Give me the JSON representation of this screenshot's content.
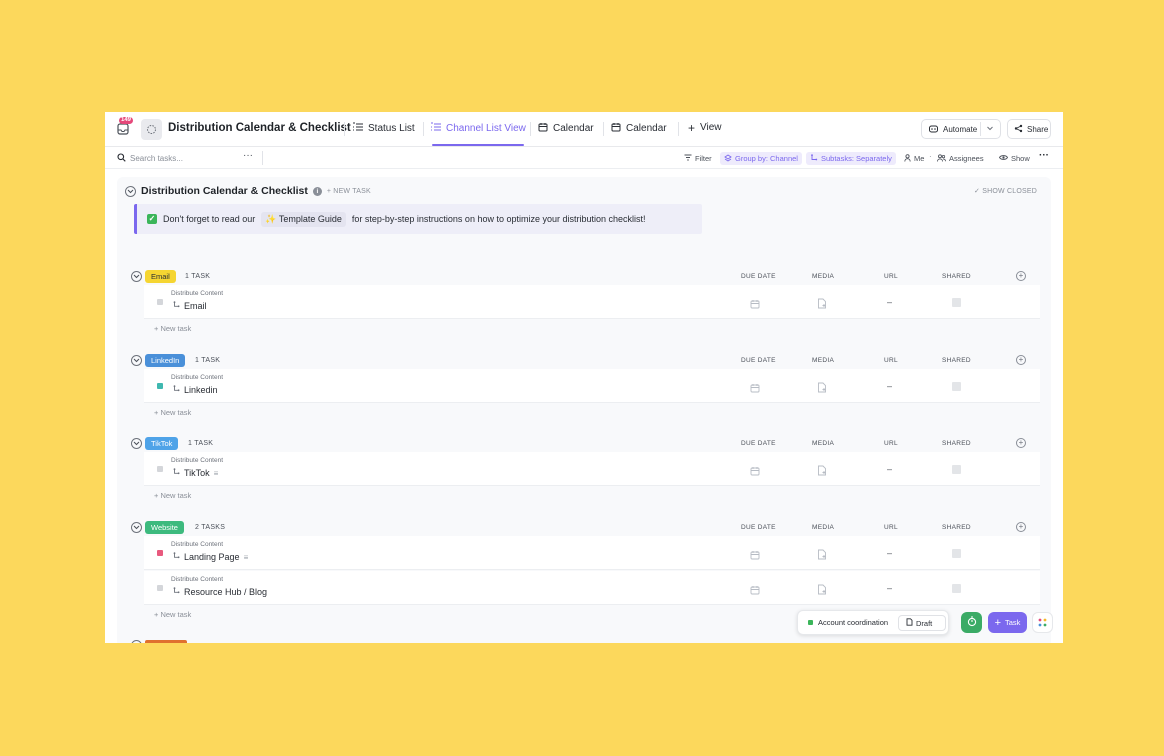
{
  "header": {
    "notification_count": "149",
    "title": "Distribution Calendar & Checklist",
    "tabs": [
      {
        "label": "Status List"
      },
      {
        "label": "Channel List View"
      },
      {
        "label": "Calendar"
      },
      {
        "label": "Calendar"
      }
    ],
    "add_view": "View",
    "automate": "Automate",
    "share": "Share"
  },
  "toolbar": {
    "search_placeholder": "Search tasks...",
    "filter": "Filter",
    "group_by": "Group by: Channel",
    "subtasks": "Subtasks: Separately",
    "me": "Me",
    "assignees": "Assignees",
    "show": "Show"
  },
  "list": {
    "title": "Distribution Calendar & Checklist",
    "new_task": "+ NEW TASK",
    "show_closed": "SHOW CLOSED",
    "callout_before": "Don't forget to read our",
    "callout_guide": "Template Guide",
    "callout_after": "for step-by-step instructions on how to optimize your distribution checklist!"
  },
  "columns": {
    "due_date": "DUE DATE",
    "media": "MEDIA",
    "url": "URL",
    "shared": "SHARED"
  },
  "groups": [
    {
      "name": "Email",
      "color": "#f5d532",
      "text_color": "#292d34",
      "count": "1 TASK",
      "tasks": [
        {
          "parent": "Distribute Content",
          "name": "Email",
          "status_color": "#d4d6da",
          "url": "–"
        }
      ]
    },
    {
      "name": "LinkedIn",
      "color": "#4a90d9",
      "text_color": "#ffffff",
      "count": "1 TASK",
      "tasks": [
        {
          "parent": "Distribute Content",
          "name": "Linkedin",
          "status_color": "#3fb8b0",
          "url": "–"
        }
      ]
    },
    {
      "name": "TikTok",
      "color": "#4fa3e8",
      "text_color": "#ffffff",
      "count": "1 TASK",
      "tasks": [
        {
          "parent": "Distribute Content",
          "name": "TikTok",
          "status_color": "#d4d6da",
          "url": "–"
        }
      ]
    },
    {
      "name": "Website",
      "color": "#3dba7e",
      "text_color": "#ffffff",
      "count": "2 TASKS",
      "tasks": [
        {
          "parent": "Distribute Content",
          "name": "Landing Page",
          "status_color": "#e8597e",
          "url": "–"
        },
        {
          "parent": "Distribute Content",
          "name": "Resource Hub / Blog",
          "status_color": "#d4d6da",
          "url": "–"
        }
      ]
    }
  ],
  "new_task_row": "+ New task",
  "floating": {
    "account": "Account coordination",
    "draft": "Draft",
    "task": "Task"
  }
}
